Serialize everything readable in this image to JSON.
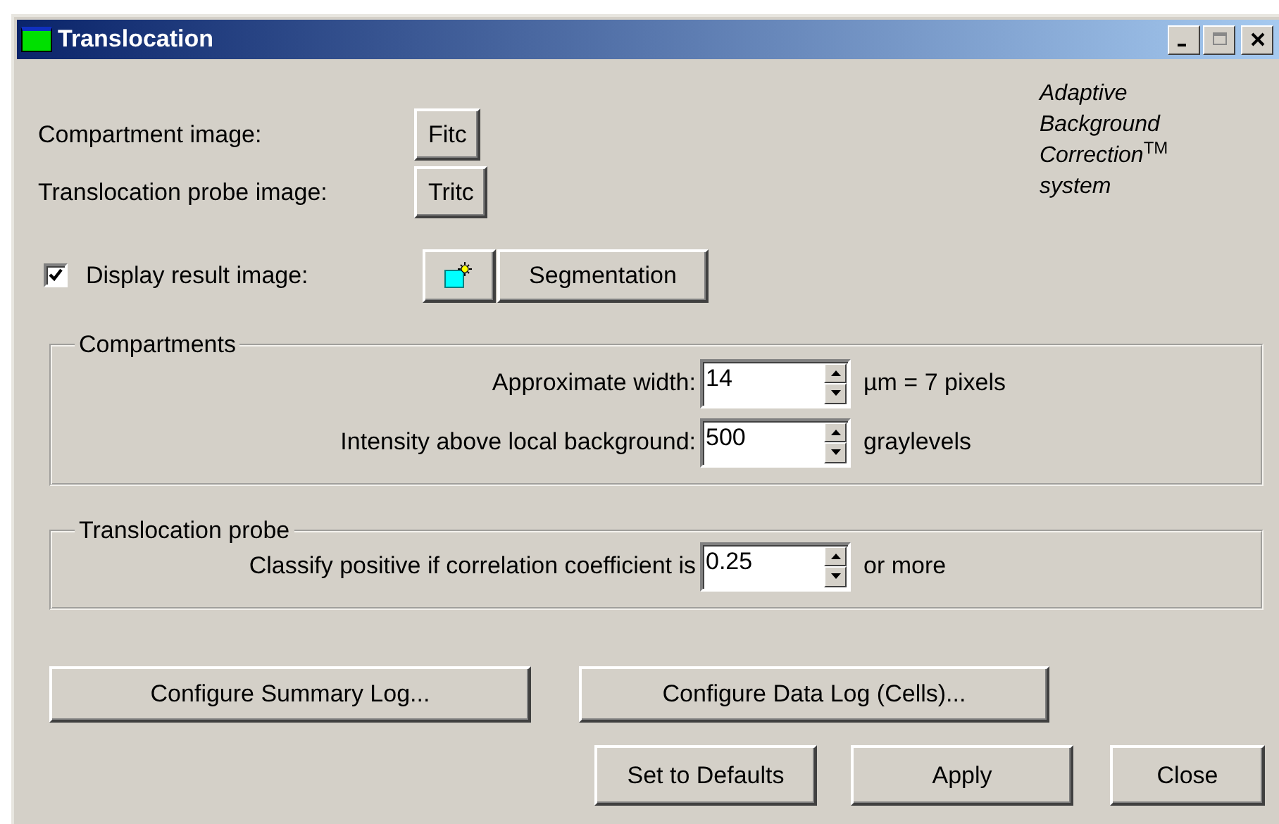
{
  "window": {
    "title": "Translocation"
  },
  "image_rows": [
    {
      "label": "Compartment image:",
      "button": "Fitc"
    },
    {
      "label": "Translocation probe image:",
      "button": "Tritc"
    }
  ],
  "display_result": {
    "label": "Display result image:",
    "checked": true,
    "button": "Segmentation"
  },
  "brand_text": [
    "Adaptive",
    "Background",
    "Correction$^{TM}$",
    "system"
  ],
  "groups": [
    {
      "title": "Compartments",
      "fields": [
        {
          "label": "Approximate width:",
          "value": "14",
          "unit": "µm = 7 pixels"
        },
        {
          "label": "Intensity above local background:",
          "value": "500",
          "unit": "graylevels"
        }
      ]
    },
    {
      "title": "Translocation probe",
      "fields": [
        {
          "label": "Classify positive if correlation coefficient is",
          "value": "0.25",
          "unit": "or more"
        }
      ]
    }
  ],
  "log_buttons": [
    "Configure Summary Log...",
    "Configure Data Log (Cells)..."
  ],
  "action_buttons": [
    "Set to Defaults",
    "Apply",
    "Close"
  ]
}
